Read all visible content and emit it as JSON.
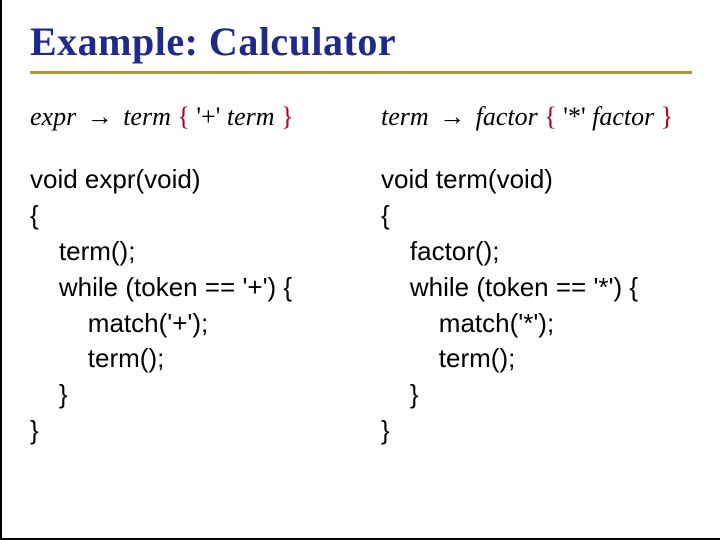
{
  "title": "Example: Calculator",
  "left": {
    "rule": {
      "lhs": "expr",
      "arrow": "→",
      "rhs1": "term",
      "openBrace": "{",
      "lit": "'+'",
      "rhs2": "term",
      "closeBrace": "}"
    },
    "code": "void expr(void)\n{\n    term();\n    while (token == '+') {\n        match('+');\n        term();\n    }\n}"
  },
  "right": {
    "rule": {
      "lhs": "term",
      "arrow": "→",
      "rhs1": "factor",
      "openBrace": "{",
      "lit": "'*'",
      "rhs2": "factor",
      "closeBrace": "}"
    },
    "code": "void term(void)\n{\n    factor();\n    while (token == '*') {\n        match('*');\n        term();\n    }\n}"
  }
}
